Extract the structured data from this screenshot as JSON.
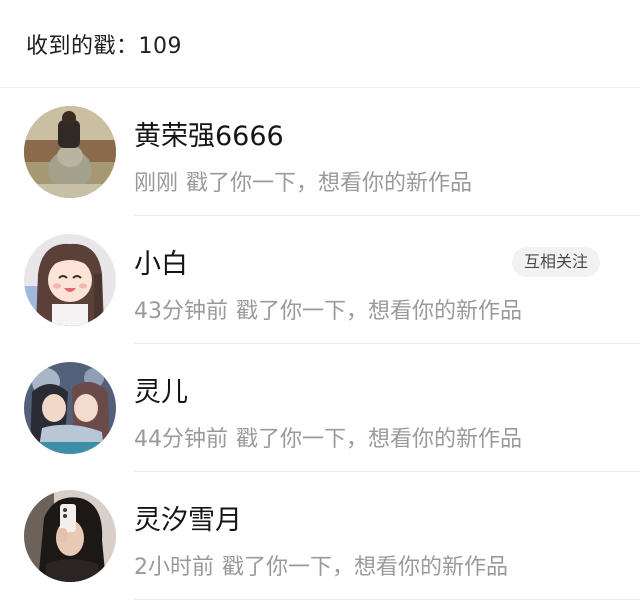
{
  "header": {
    "title": "收到的戳：109"
  },
  "items": [
    {
      "name": "黄荣强6666",
      "time": "刚刚",
      "message": "戳了你一下，想看你的新作品",
      "badge": ""
    },
    {
      "name": "小白",
      "time": "43分钟前",
      "message": "戳了你一下，想看你的新作品",
      "badge": "互相关注"
    },
    {
      "name": "灵儿",
      "time": "44分钟前",
      "message": "戳了你一下，想看你的新作品",
      "badge": ""
    },
    {
      "name": "灵汐雪月",
      "time": "2小时前",
      "message": "戳了你一下，想看你的新作品",
      "badge": ""
    }
  ]
}
